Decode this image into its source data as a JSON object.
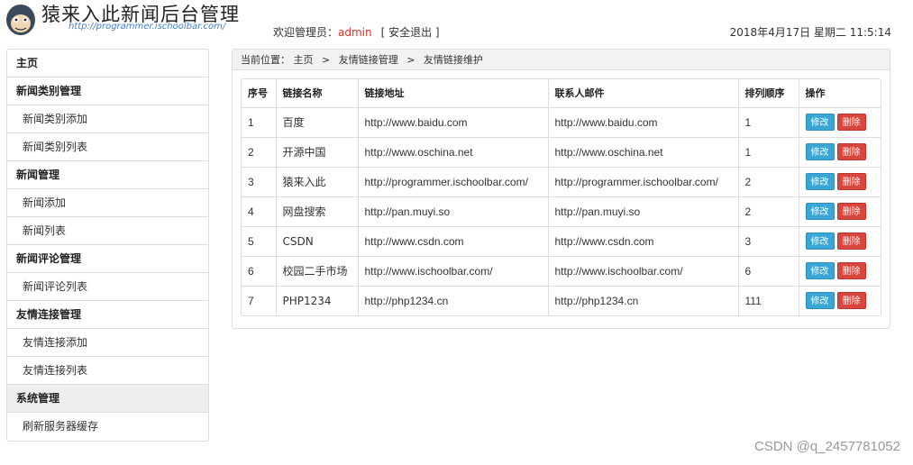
{
  "header": {
    "site_title": "猿来入此新闻后台管理",
    "site_url": "http://programmer.ischoolbar.com/",
    "welcome_prefix": "欢迎管理员：",
    "admin_name": "admin",
    "logout_label": "[ 安全退出 ]",
    "datetime": "2018年4月17日 星期二 11:5:14"
  },
  "sidebar": {
    "items": [
      {
        "label": "主页",
        "type": "head"
      },
      {
        "label": "新闻类别管理",
        "type": "head"
      },
      {
        "label": "新闻类别添加",
        "type": "sub"
      },
      {
        "label": "新闻类别列表",
        "type": "sub"
      },
      {
        "label": "新闻管理",
        "type": "head"
      },
      {
        "label": "新闻添加",
        "type": "sub"
      },
      {
        "label": "新闻列表",
        "type": "sub"
      },
      {
        "label": "新闻评论管理",
        "type": "head"
      },
      {
        "label": "新闻评论列表",
        "type": "sub"
      },
      {
        "label": "友情连接管理",
        "type": "head"
      },
      {
        "label": "友情连接添加",
        "type": "sub"
      },
      {
        "label": "友情连接列表",
        "type": "sub"
      },
      {
        "label": "系统管理",
        "type": "head"
      },
      {
        "label": "刷新服务器缓存",
        "type": "sub"
      }
    ]
  },
  "breadcrumb": {
    "prefix": "当前位置：",
    "items": [
      "主页",
      "友情链接管理",
      "友情链接维护"
    ],
    "separator": ">"
  },
  "table": {
    "headers": [
      "序号",
      "链接名称",
      "链接地址",
      "联系人邮件",
      "排列顺序",
      "操作"
    ],
    "rows": [
      [
        "1",
        "百度",
        "http://www.baidu.com",
        "http://www.baidu.com",
        "1"
      ],
      [
        "2",
        "开源中国",
        "http://www.oschina.net",
        "http://www.oschina.net",
        "1"
      ],
      [
        "3",
        "猿来入此",
        "http://programmer.ischoolbar.com/",
        "http://programmer.ischoolbar.com/",
        "2"
      ],
      [
        "4",
        "网盘搜索",
        "http://pan.muyi.so",
        "http://pan.muyi.so",
        "2"
      ],
      [
        "5",
        "CSDN",
        "http://www.csdn.com",
        "http://www.csdn.com",
        "3"
      ],
      [
        "6",
        "校园二手市场",
        "http://www.ischoolbar.com/",
        "http://www.ischoolbar.com/",
        "6"
      ],
      [
        "7",
        "PHP1234",
        "http://php1234.cn",
        "http://php1234.cn",
        "111"
      ]
    ],
    "edit_label": "修改",
    "delete_label": "删除"
  },
  "colors": {
    "admin_name": "#d9342b",
    "edit_button": "#39a6d6",
    "delete_button": "#d8463e",
    "breadcrumb_bg": "#f2f2f2"
  },
  "icons": {
    "logo": "monkey-logo-icon"
  },
  "watermark": "CSDN @q_2457781052"
}
